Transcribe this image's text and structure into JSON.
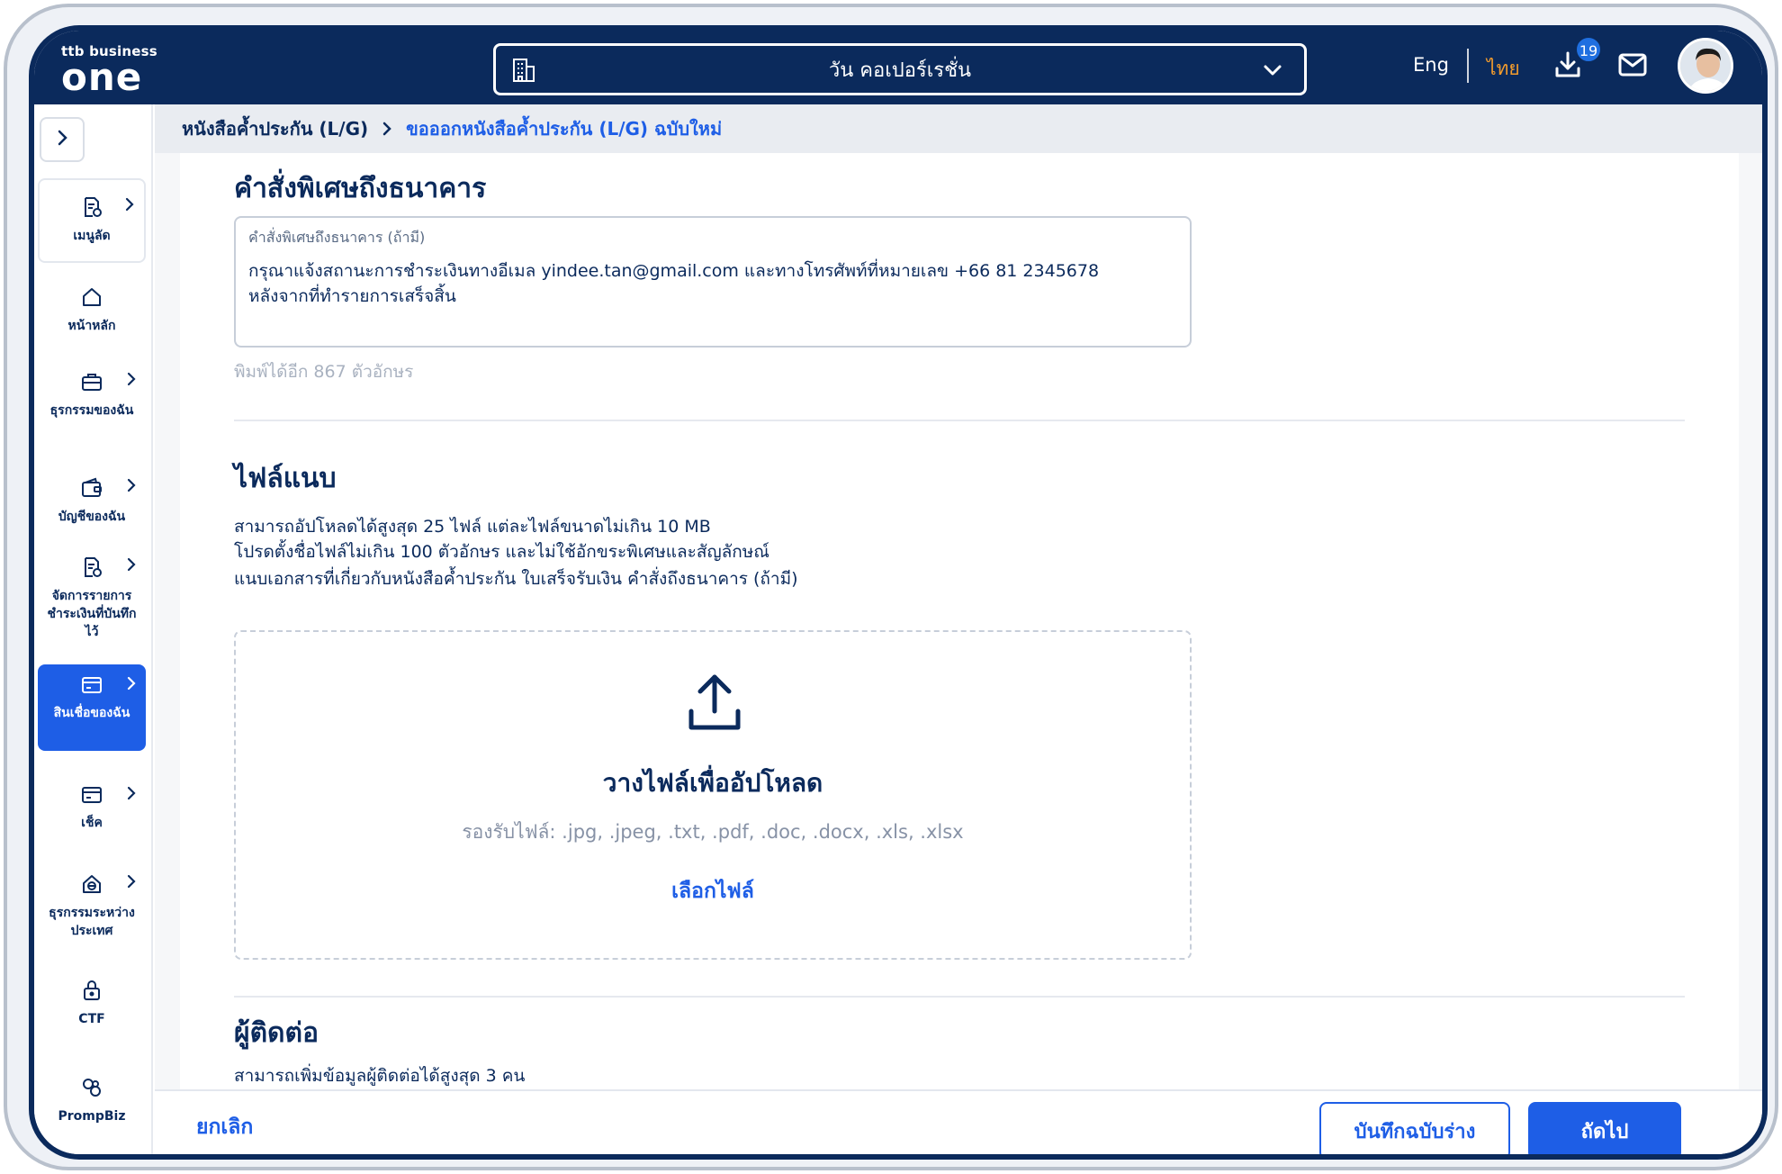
{
  "header": {
    "logo_small": "ttb business",
    "logo_big": "one",
    "company": "วัน คอเปอร์เรชั่น",
    "lang_eng": "Eng",
    "lang_th": "ไทย",
    "download_badge": "19"
  },
  "sidebar": {
    "items": [
      {
        "label": "เมนูลัด",
        "icon": "shortcut-doc-icon"
      },
      {
        "label": "หน้าหลัก",
        "icon": "home-icon"
      },
      {
        "label": "ธุรกรรมของฉัน",
        "icon": "briefcase-icon"
      },
      {
        "label": "บัญชีของฉัน",
        "icon": "wallet-icon"
      },
      {
        "label": "จัดการรายการชำระเงินที่บันทึกไว้",
        "icon": "doc-edit-icon"
      },
      {
        "label": "สินเชื่อของฉัน",
        "icon": "card-icon"
      },
      {
        "label": "เช็ค",
        "icon": "cheque-icon"
      },
      {
        "label": "ธุรกรรมระหว่างประเทศ",
        "icon": "globe-house-icon"
      },
      {
        "label": "CTF",
        "icon": "lock-icon"
      },
      {
        "label": "PrompBiz",
        "icon": "prompbiz-icon"
      }
    ]
  },
  "breadcrumb": {
    "level1": "หนังสือค้ำประกัน (L/G)",
    "level2": "ขอออกหนังสือค้ำประกัน (L/G) ฉบับใหม่"
  },
  "instruction": {
    "title": "คำสั่งพิเศษถึงธนาคาร",
    "field_label": "คำสั่งพิเศษถึงธนาคาร (ถ้ามี)",
    "field_value": "กรุณาแจ้งสถานะการชำระเงินทางอีเมล yindee.tan@gmail.com และทางโทรศัพท์ที่หมายเลข +66 81 2345678\nหลังจากที่ทำรายการเสร็จสิ้น",
    "remaining": "พิมพ์ได้อีก 867 ตัวอักษร"
  },
  "attachment": {
    "title": "ไฟล์แนบ",
    "desc1": "สามารถอัปโหลดได้สูงสุด 25 ไฟล์ แต่ละไฟล์ขนาดไม่เกิน 10 MB",
    "desc2": "โปรดตั้งชื่อไฟล์ไม่เกิน 100 ตัวอักษร และไม่ใช้อักขระพิเศษและสัญลักษณ์",
    "desc3": "แนบเอกสารที่เกี่ยวกับหนังสือค้ำประกัน ใบเสร็จรับเงิน คำสั่งถึงธนาคาร (ถ้ามี)",
    "drop_title": "วางไฟล์เพื่ออัปโหลด",
    "accepted": "รองรับไฟล์: .jpg, .jpeg, .txt, .pdf, .doc, .docx, .xls, .xlsx",
    "choose_file": "เลือกไฟล์"
  },
  "contact": {
    "title": "ผู้ติดต่อ",
    "desc": "สามารถเพิ่มข้อมูลผู้ติดต่อได้สูงสุด 3 คน"
  },
  "footer": {
    "cancel": "ยกเลิก",
    "save_draft": "บันทึกฉบับร่าง",
    "next": "ถัดไป"
  },
  "colors": {
    "navy": "#0b2a5c",
    "accent": "#1e5ee6",
    "lang_active": "#f39c2d"
  }
}
